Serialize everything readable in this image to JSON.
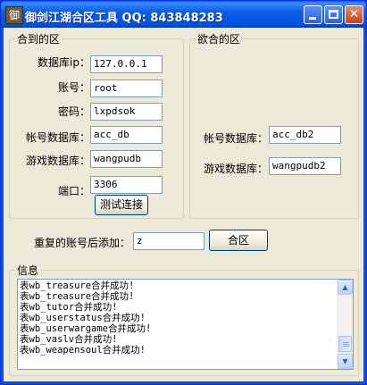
{
  "window": {
    "icon_glyph": "御",
    "title": "御剑江湖合区工具  QQ: 843848283",
    "icons": [
      "app-icon",
      "minimize-icon",
      "maximize-icon",
      "close-icon"
    ]
  },
  "source_group": {
    "legend": "合到的区",
    "db_ip_label": "数据库ip：",
    "db_ip_value": "127.0.0.1",
    "account_label": "账号：",
    "account_value": "root",
    "password_label": "密码：",
    "password_value": "lxpdsok",
    "account_db_label": "帐号数据库：",
    "account_db_value": "acc_db",
    "game_db_label": "游戏数据库：",
    "game_db_value": "wangpudb",
    "port_label": "端口：",
    "port_value": "3306",
    "test_button": "测试连接"
  },
  "target_group": {
    "legend": "欲合的区",
    "account_db_label": "帐号数据库：",
    "account_db_value": "acc_db2",
    "game_db_label": "游戏数据库：",
    "game_db_value": "wangpudb2"
  },
  "merge": {
    "suffix_label": "重复的账号后添加：",
    "suffix_value": "z",
    "merge_button": "合区"
  },
  "info": {
    "legend": "信息",
    "lines": [
      "表wb_treasure合并成功!",
      "表wb_treasure合并成功!",
      "表wb_tutor合并成功!",
      "表wb_userstatus合并成功!",
      "表wb_userwargame合并成功!",
      "表wb_vaslv合并成功!",
      "表wb_weapensoul合并成功!"
    ],
    "scroll_position": 0.95
  }
}
